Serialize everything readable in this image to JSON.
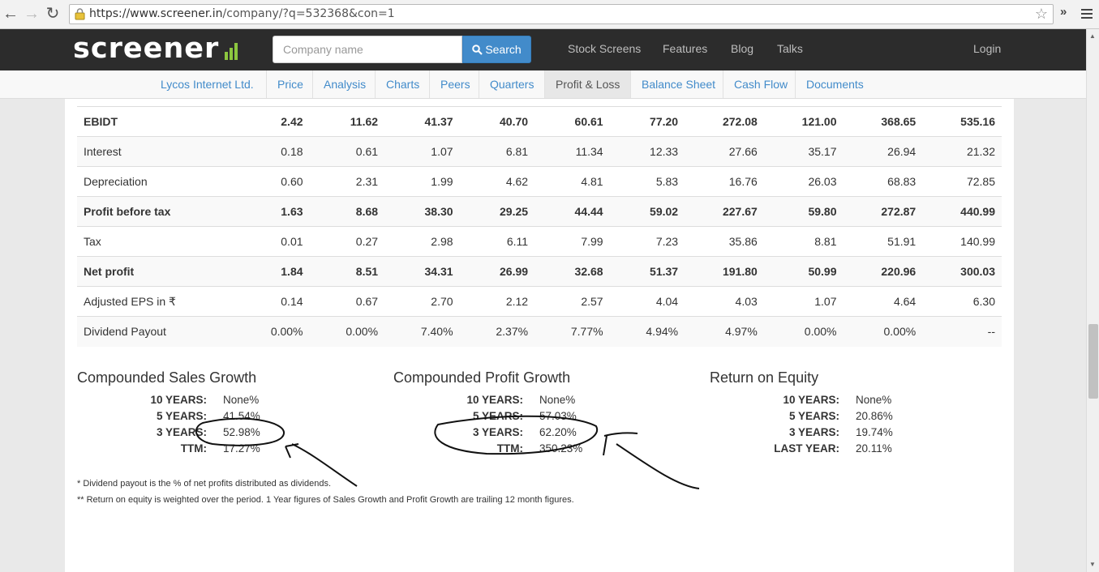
{
  "browser": {
    "url_host": "https://www.screener.in",
    "url_path": "/company/?q=532368&con=1"
  },
  "site": {
    "logo": "screener",
    "search_placeholder": "Company name",
    "search_button": "Search",
    "nav": [
      "Stock Screens",
      "Features",
      "Blog",
      "Talks"
    ],
    "login": "Login"
  },
  "subnav": [
    "Lycos Internet Ltd.",
    "Price",
    "Analysis",
    "Charts",
    "Peers",
    "Quarters",
    "Profit & Loss",
    "Balance Sheet",
    "Cash Flow",
    "Documents"
  ],
  "table": {
    "rows": [
      {
        "label": "EBIDT",
        "bold": true,
        "values": [
          "2.42",
          "11.62",
          "41.37",
          "40.70",
          "60.61",
          "77.20",
          "272.08",
          "121.00",
          "368.65",
          "535.16"
        ]
      },
      {
        "label": "Interest",
        "bold": false,
        "values": [
          "0.18",
          "0.61",
          "1.07",
          "6.81",
          "11.34",
          "12.33",
          "27.66",
          "35.17",
          "26.94",
          "21.32"
        ]
      },
      {
        "label": "Depreciation",
        "bold": false,
        "values": [
          "0.60",
          "2.31",
          "1.99",
          "4.62",
          "4.81",
          "5.83",
          "16.76",
          "26.03",
          "68.83",
          "72.85"
        ]
      },
      {
        "label": "Profit before tax",
        "bold": true,
        "values": [
          "1.63",
          "8.68",
          "38.30",
          "29.25",
          "44.44",
          "59.02",
          "227.67",
          "59.80",
          "272.87",
          "440.99"
        ]
      },
      {
        "label": "Tax",
        "bold": false,
        "values": [
          "0.01",
          "0.27",
          "2.98",
          "6.11",
          "7.99",
          "7.23",
          "35.86",
          "8.81",
          "51.91",
          "140.99"
        ]
      },
      {
        "label": "Net profit",
        "bold": true,
        "values": [
          "1.84",
          "8.51",
          "34.31",
          "26.99",
          "32.68",
          "51.37",
          "191.80",
          "50.99",
          "220.96",
          "300.03"
        ]
      },
      {
        "label": "Adjusted EPS in ₹",
        "bold": false,
        "values": [
          "0.14",
          "0.67",
          "2.70",
          "2.12",
          "2.57",
          "4.04",
          "4.03",
          "1.07",
          "4.64",
          "6.30"
        ]
      },
      {
        "label": "Dividend Payout",
        "bold": false,
        "values": [
          "0.00%",
          "0.00%",
          "7.40%",
          "2.37%",
          "7.77%",
          "4.94%",
          "4.97%",
          "0.00%",
          "0.00%",
          "--"
        ]
      }
    ]
  },
  "growth": [
    {
      "title": "Compounded Sales Growth",
      "rows": [
        [
          "10 YEARS:",
          "None%"
        ],
        [
          "5 YEARS:",
          "41.54%"
        ],
        [
          "3 YEARS:",
          "52.98%"
        ],
        [
          "TTM:",
          "17.27%"
        ]
      ]
    },
    {
      "title": "Compounded Profit Growth",
      "rows": [
        [
          "10 YEARS:",
          "None%"
        ],
        [
          "5 YEARS:",
          "57.03%"
        ],
        [
          "3 YEARS:",
          "62.20%"
        ],
        [
          "TTM:",
          "350.23%"
        ]
      ]
    },
    {
      "title": "Return on Equity",
      "rows": [
        [
          "10 YEARS:",
          "None%"
        ],
        [
          "5 YEARS:",
          "20.86%"
        ],
        [
          "3 YEARS:",
          "19.74%"
        ],
        [
          "LAST YEAR:",
          "20.11%"
        ]
      ]
    }
  ],
  "notes": [
    "* Dividend payout is the % of net profits distributed as dividends.",
    "** Return on equity is weighted over the period. 1 Year figures of Sales Growth and Profit Growth are trailing 12 month figures."
  ]
}
